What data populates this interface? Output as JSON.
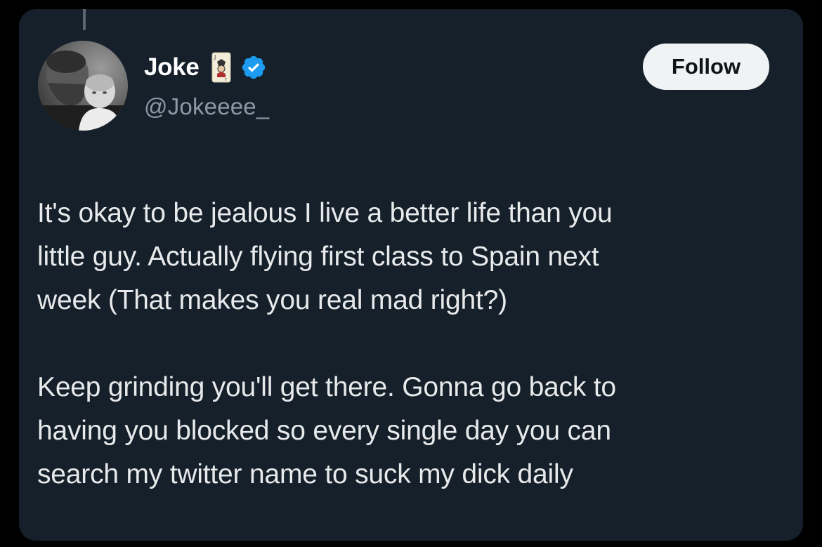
{
  "tweet": {
    "author": {
      "display_name": "Joke",
      "handle": "@Jokeeee_",
      "verified": true,
      "name_emoji": "joker-card-emoji",
      "avatar": "profile-photo"
    },
    "follow_button_label": "Follow",
    "paragraph_1_lines": [
      "It's okay to be jealous I live a better life than you",
      "little guy. Actually flying first class to Spain next",
      "week (That makes you real mad right?)"
    ],
    "paragraph_2_lines": [
      "Keep grinding you'll get there. Gonna go back to",
      "having you blocked so every single day you can",
      "search my twitter name to suck my dick daily"
    ]
  },
  "colors": {
    "card_background": "#15202b",
    "page_background": "#000000",
    "text_primary": "#e7e9ea",
    "text_secondary": "#8b98a5",
    "verified_badge": "#1d9bf0",
    "follow_button_bg": "#eff3f4"
  }
}
